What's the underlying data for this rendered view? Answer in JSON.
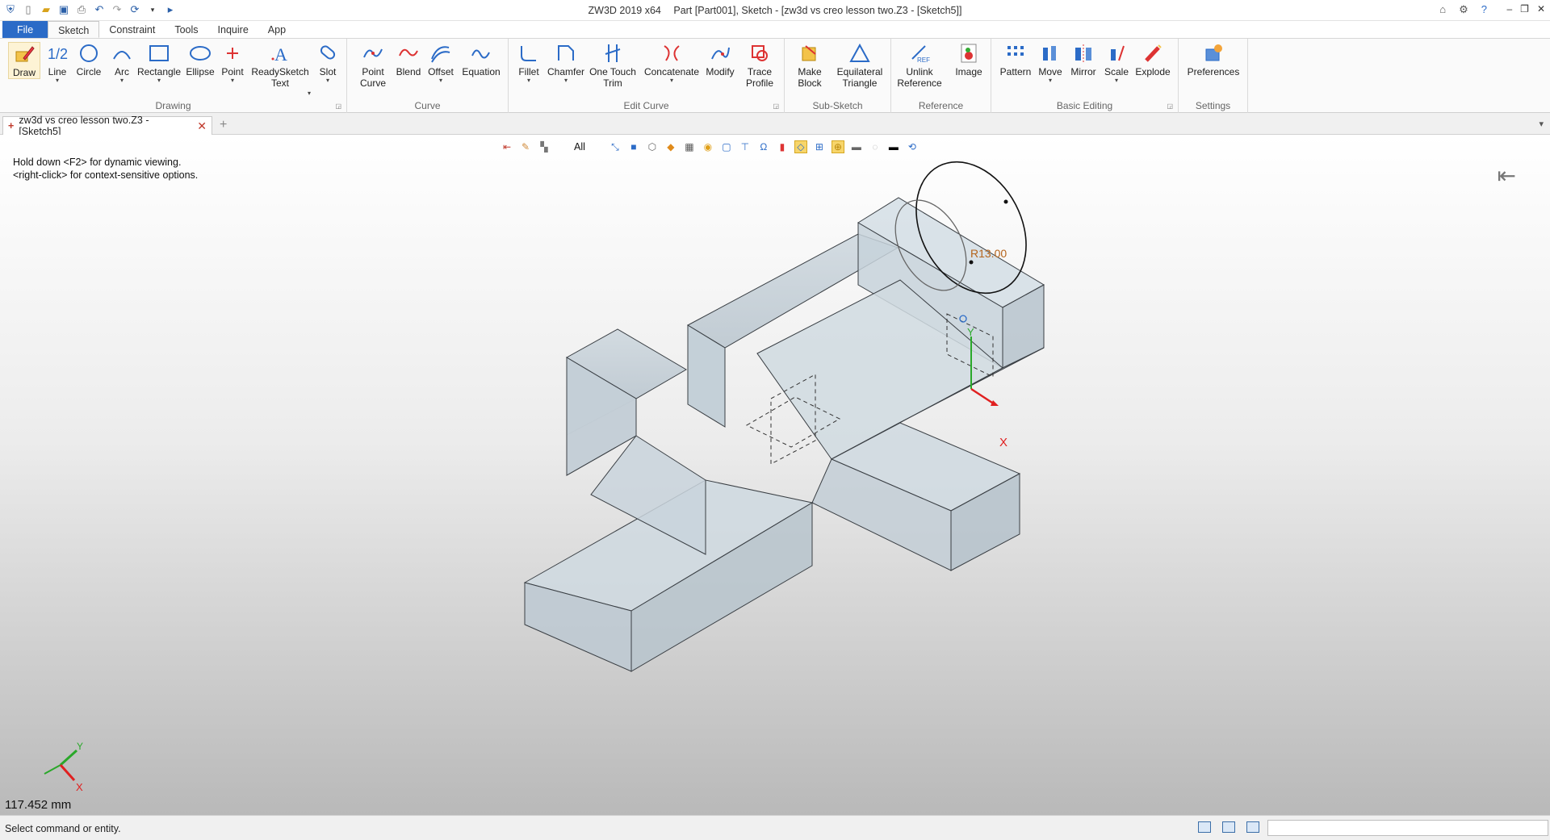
{
  "app": {
    "title_product": "ZW3D 2019  x64",
    "title_doc": "Part [Part001],  Sketch - [zw3d vs creo lesson two.Z3 - [Sketch5]]"
  },
  "menu": {
    "file": "File",
    "tabs": [
      "Sketch",
      "Constraint",
      "Tools",
      "Inquire",
      "App"
    ]
  },
  "ribbon": {
    "groups": [
      {
        "label": "Drawing"
      },
      {
        "label": "Curve"
      },
      {
        "label": "Edit Curve"
      },
      {
        "label": "Sub-Sketch"
      },
      {
        "label": "Reference"
      },
      {
        "label": "Basic Editing"
      },
      {
        "label": "Settings"
      }
    ],
    "tools": {
      "draw": "Draw",
      "line": "Line",
      "circle": "Circle",
      "arc": "Arc",
      "rectangle": "Rectangle",
      "ellipse": "Ellipse",
      "point": "Point",
      "readysketch_1": "ReadySketch",
      "readysketch_2": "Text",
      "slot": "Slot",
      "point_curve_1": "Point",
      "point_curve_2": "Curve",
      "blend": "Blend",
      "offset": "Offset",
      "equation": "Equation",
      "fillet": "Fillet",
      "chamfer": "Chamfer",
      "one_touch_1": "One Touch",
      "one_touch_2": "Trim",
      "concatenate": "Concatenate",
      "modify": "Modify",
      "trace_1": "Trace",
      "trace_2": "Profile",
      "make_block_1": "Make",
      "make_block_2": "Block",
      "equi_1": "Equilateral",
      "equi_2": "Triangle",
      "unlink_1": "Unlink",
      "unlink_2": "Reference",
      "image": "Image",
      "pattern": "Pattern",
      "move": "Move",
      "mirror": "Mirror",
      "scale": "Scale",
      "explode": "Explode",
      "preferences": "Preferences"
    }
  },
  "document": {
    "tab_label": "zw3d vs creo lesson two.Z3 - [Sketch5]"
  },
  "viewport": {
    "hint_line1": "Hold down <F2> for dynamic viewing.",
    "hint_line2": "<right-click> for context-sensitive options.",
    "filter": "All",
    "dimension": "R13.00",
    "axis_x": "X",
    "axis_y": "Y",
    "scale_readout": "117.452 mm"
  },
  "status": {
    "message": "Select command or entity."
  },
  "colors": {
    "file_tab": "#2b6bc7",
    "solid_face": "#c9d3da",
    "dimension_text": "#b5651d",
    "axis_x": "#e02020",
    "axis_y": "#20b020"
  }
}
